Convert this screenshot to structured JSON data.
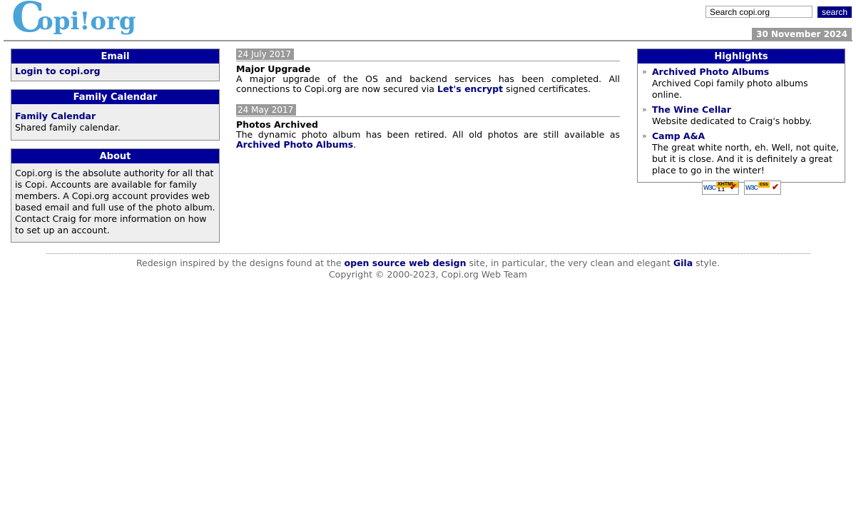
{
  "header": {
    "logo_big": "C",
    "logo_rest": "opi",
    "logo_dot": "!",
    "logo_tld": "org",
    "search_placeholder": "Search copi.org",
    "search_value": "Search copi.org",
    "search_button": "search",
    "date": "30 November 2024"
  },
  "left": {
    "email": {
      "title": "Email",
      "link": "Login to copi.org"
    },
    "calendar": {
      "title": "Family Calendar",
      "link": "Family Calendar",
      "text": "Shared family calendar."
    },
    "about": {
      "title": "About",
      "text": "Copi.org is the absolute authority for all that is Copi. Accounts are available for family members. A Copi.org account provides web based email and full use of the photo album. Contact Craig for more information on how to set up an account."
    }
  },
  "news": [
    {
      "date": "24 July 2017",
      "title": "Major Upgrade",
      "text_before": "A major upgrade of the OS and backend services has been completed. All connections to Copi.org are now secured via ",
      "link": "Let's encrypt",
      "text_after": " signed certificates."
    },
    {
      "date": "24 May 2017",
      "title": "Photos Archived",
      "text_before": "The dynamic photo album has been retired. All old photos are still available as ",
      "link": "Archived Photo Albums",
      "text_after": "."
    }
  ],
  "highlights": {
    "title": "Highlights",
    "bullet": "»",
    "items": [
      {
        "link": "Archived Photo Albums",
        "text": "Archived Copi family photo albums online."
      },
      {
        "link": "The Wine Cellar",
        "text": "Website dedicated to Craig's hobby."
      },
      {
        "link": "Camp A&A",
        "text": "The great white north, eh. Well, not quite, but it is close. And it is definitely a great place to go in the winter!"
      }
    ]
  },
  "badges": {
    "xhtml": {
      "w3c": "W3C",
      "tag": "XHTML 1.1",
      "check": "✔"
    },
    "css": {
      "w3c": "W3C",
      "tag": "css",
      "check": "✔"
    }
  },
  "footer": {
    "line1_before": "Redesign inspired by the designs found at the ",
    "line1_link1": "open source web design",
    "line1_middle": " site, in particular, the very clean and elegant ",
    "line1_link2": "Gila",
    "line1_after": " style.",
    "line2": "Copyright © 2000-2023, Copi.org Web Team"
  },
  "colors": {
    "accent": "#000099",
    "link": "#00007f",
    "logo": "#4aa3d9",
    "date_badge": "#999999"
  }
}
